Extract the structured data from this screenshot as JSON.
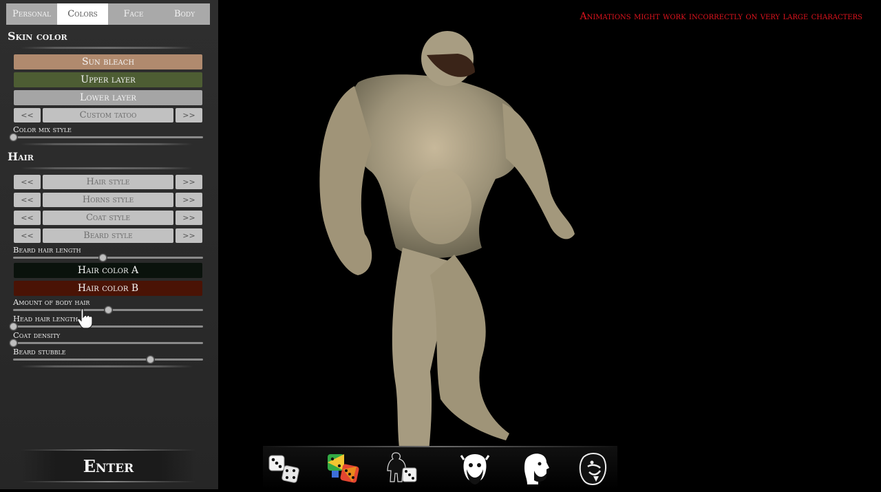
{
  "tabs": [
    {
      "label": "Personal",
      "active": false
    },
    {
      "label": "Colors",
      "active": true
    },
    {
      "label": "Face",
      "active": false
    },
    {
      "label": "Body",
      "active": false
    }
  ],
  "skin": {
    "title": "Skin color",
    "sun_bleach": "Sun bleach",
    "upper_layer": "Upper layer",
    "lower_layer": "Lower layer",
    "tatoo": {
      "prev": "<<",
      "label": "Custom tatoo",
      "next": ">>"
    },
    "mix_label": "Color mix style",
    "mix_value": 0.0
  },
  "hair": {
    "title": "Hair",
    "selectors": [
      {
        "prev": "<<",
        "label": "Hair style",
        "next": ">>"
      },
      {
        "prev": "<<",
        "label": "Horns style",
        "next": ">>"
      },
      {
        "prev": "<<",
        "label": "Coat style",
        "next": ">>"
      },
      {
        "prev": "<<",
        "label": "Beard style",
        "next": ">>"
      }
    ],
    "beard_length_label": "Beard hair length",
    "beard_length_value": 0.47,
    "color_a": "Hair color A",
    "color_b": "Hair color B",
    "body_hair_label": "Amount of body hair",
    "body_hair_value": 0.5,
    "head_hair_label": "Head hair length",
    "head_hair_value": 0.0,
    "coat_density_label": "Coat density",
    "coat_density_value": 0.0,
    "beard_stubble_label": "Beard stubble",
    "beard_stubble_value": 0.72
  },
  "enter_label": "Enter",
  "warning": "Animations might work incorrectly on very large characters",
  "bottom_icons": [
    "dice-white-icon",
    "dice-color-icon",
    "random-body-icon",
    "random-face-icon",
    "head-profile-icon",
    "creature-head-icon"
  ],
  "colors": {
    "sun_bleach": "#b08a6e",
    "upper_layer": "#4d5d33",
    "lower_layer": "#a5a5a5",
    "hair_a": "#0a120c",
    "hair_b": "#4a1305",
    "warning": "#e0141e"
  }
}
